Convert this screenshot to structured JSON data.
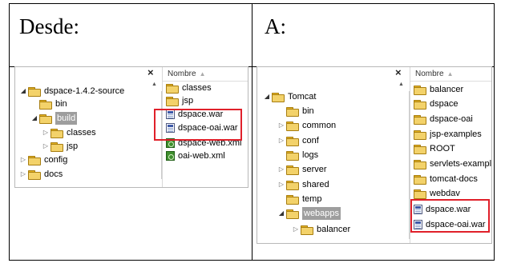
{
  "left_cell": {
    "heading": "Desde:",
    "tree": [
      {
        "label": "dspace-1.4.2-source",
        "toggle": "◢"
      },
      {
        "label": "bin",
        "toggle": ""
      },
      {
        "label": "build",
        "toggle": "◢"
      },
      {
        "label": "classes",
        "toggle": "▷"
      },
      {
        "label": "jsp",
        "toggle": "▷"
      },
      {
        "label": "config",
        "toggle": "▷"
      },
      {
        "label": "docs",
        "toggle": "▷"
      }
    ],
    "column_header": "Nombre",
    "files": [
      {
        "label": "classes",
        "icon": "folder-icon"
      },
      {
        "label": "jsp",
        "icon": "folder-icon"
      },
      {
        "label": "dspace.war",
        "icon": "war-file-icon"
      },
      {
        "label": "dspace-oai.war",
        "icon": "war-file-icon"
      },
      {
        "label": "dspace-web.xml",
        "icon": "xml-file-icon"
      },
      {
        "label": "oai-web.xml",
        "icon": "xml-file-icon"
      }
    ]
  },
  "right_cell": {
    "heading": "A:",
    "tree": [
      {
        "label": "Tomcat",
        "toggle": "◢"
      },
      {
        "label": "bin",
        "toggle": ""
      },
      {
        "label": "common",
        "toggle": "▷"
      },
      {
        "label": "conf",
        "toggle": "▷"
      },
      {
        "label": "logs",
        "toggle": ""
      },
      {
        "label": "server",
        "toggle": "▷"
      },
      {
        "label": "shared",
        "toggle": "▷"
      },
      {
        "label": "temp",
        "toggle": ""
      },
      {
        "label": "webapps",
        "toggle": "◢"
      },
      {
        "label": "balancer",
        "toggle": "▷"
      }
    ],
    "column_header": "Nombre",
    "files": [
      {
        "label": "balancer",
        "icon": "folder-icon"
      },
      {
        "label": "dspace",
        "icon": "folder-icon"
      },
      {
        "label": "dspace-oai",
        "icon": "folder-icon"
      },
      {
        "label": "jsp-examples",
        "icon": "folder-icon"
      },
      {
        "label": "ROOT",
        "icon": "folder-icon"
      },
      {
        "label": "servlets-examples",
        "icon": "folder-icon"
      },
      {
        "label": "tomcat-docs",
        "icon": "folder-icon"
      },
      {
        "label": "webdav",
        "icon": "folder-icon"
      },
      {
        "label": "dspace.war",
        "icon": "war-file-icon"
      },
      {
        "label": "dspace-oai.war",
        "icon": "war-file-icon"
      }
    ]
  },
  "ui": {
    "close_glyph": "×",
    "sort_glyph": "▲",
    "scroll_glyph": "▲"
  },
  "colors": {
    "highlight_box": "#e0202a",
    "selected_folder_bg": "#9e9e9e"
  }
}
